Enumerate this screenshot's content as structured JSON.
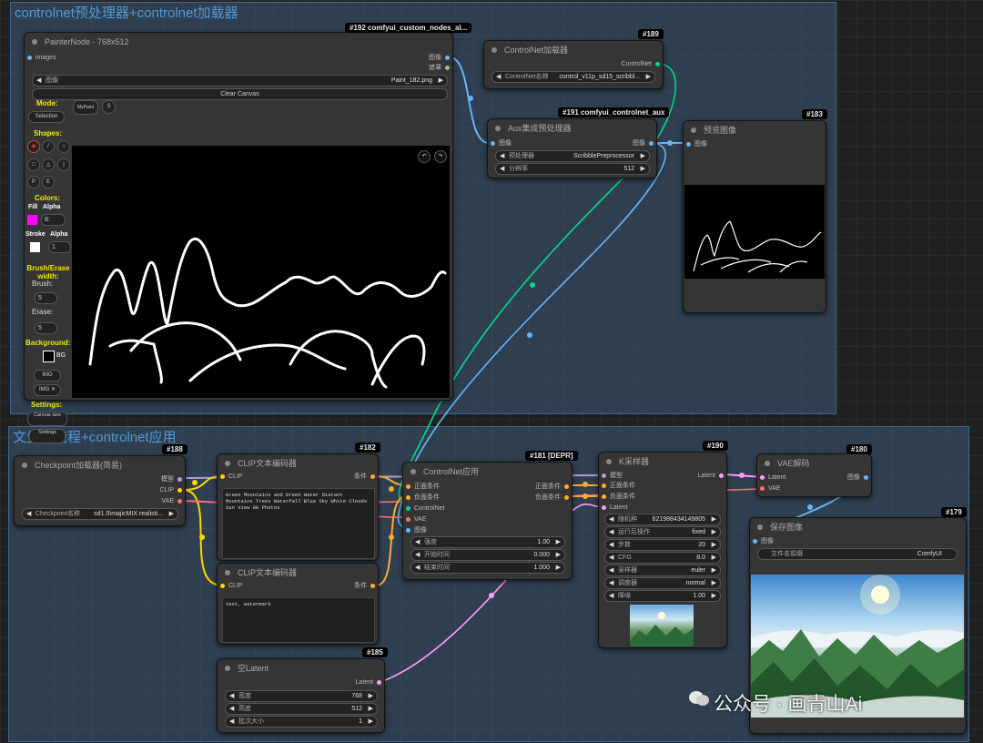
{
  "groups": {
    "top_title": "controlnet预处理器+controlnet加载器",
    "bottom_title": "文生图流程+controlnet应用"
  },
  "painter": {
    "badge": "#192 comfyui_custom_nodes_al...",
    "title": "PainterNode - 768x512",
    "in_images": "images",
    "out_image": "图像",
    "out_mask": "遮罩",
    "image_label": "图像",
    "image_value": "Paint_182.png",
    "clear_canvas": "Clear Canvas",
    "mode_label": "Mode:",
    "mode_selection": "Selection",
    "mode_mypaint": "MyPaint",
    "mode_s": "S",
    "shapes_label": "Shapes:",
    "colors_label": "Colors:",
    "fill_label": "Fill",
    "alpha_label": "Alpha",
    "fill_alpha": "8:",
    "stroke_label": "Stroke",
    "stroke_alpha": "1.",
    "brush_erase_label": "Brush/Erase width:",
    "brush_label": "Brush:",
    "brush_value": "5",
    "erase_label": "Erase:",
    "erase_value": "5",
    "background_label": "Background:",
    "bg_text": "BG",
    "img_button": "IMG",
    "img_x_button": "IMG ✕",
    "settings_label": "Settings:",
    "canvas_size_button": "Canvas size",
    "settings_button": "Settings"
  },
  "cn_loader": {
    "badge": "#189",
    "title": "ControlNet加载器",
    "out": "ControlNet",
    "widget_label": "ControlNet名称",
    "widget_value": "control_v11p_sd15_scribbl..."
  },
  "aux": {
    "badge": "#191 comfyui_controlnet_aux",
    "title": "Aux集成预处理器",
    "in": "图像",
    "out": "图像",
    "pre_label": "预处理器",
    "pre_value": "ScribblePreprocessor",
    "res_label": "分辨率",
    "res_value": "512"
  },
  "preview": {
    "badge": "#183",
    "title": "预览图像",
    "in": "图像"
  },
  "checkpoint": {
    "badge": "#188",
    "title": "Checkpoint加载器(简易)",
    "out_model": "模型",
    "out_clip": "CLIP",
    "out_vae": "VAE",
    "widget_label": "Checkpoint名称",
    "widget_value": "sd1.5\\majicMIX realisti..."
  },
  "clip_pos": {
    "badge": "#182",
    "title": "CLIP文本编码器",
    "in": "CLIP",
    "out": "条件",
    "text": "Green Mountains and Green Water Distant Mountains Trees Waterfall Blue Sky White Clouds Sun View 8K Photos"
  },
  "clip_neg": {
    "title": "CLIP文本编码器",
    "in": "CLIP",
    "out": "条件",
    "text": "text, watermark"
  },
  "cn_apply": {
    "badge": "#181 [DEPR]",
    "title": "ControlNet应用",
    "in_pos": "正面条件",
    "in_neg": "负面条件",
    "in_cn": "ControlNet",
    "in_vae": "VAE",
    "in_img": "图像",
    "out_pos": "正面条件",
    "out_neg": "负面条件",
    "strength_label": "强度",
    "strength_value": "1.00",
    "start_label": "开始时间",
    "start_value": "0.000",
    "end_label": "结束时间",
    "end_value": "1.000"
  },
  "ksampler": {
    "badge": "#190",
    "title": "K采样器",
    "in_model": "模型",
    "in_pos": "正面条件",
    "in_neg": "负面条件",
    "in_latent": "Latent",
    "out": "Latent",
    "seed_label": "随机种",
    "seed_value": "621988434149805",
    "after_label": "运行后操作",
    "after_value": "fixed",
    "steps_label": "步数",
    "steps_value": "20",
    "cfg_label": "CFG",
    "cfg_value": "8.0",
    "sampler_label": "采样器",
    "sampler_value": "euler",
    "scheduler_label": "调度器",
    "scheduler_value": "normal",
    "denoise_label": "降噪",
    "denoise_value": "1.00"
  },
  "vae": {
    "badge": "#180",
    "title": "VAE解码",
    "in_latent": "Latent",
    "in_vae": "VAE",
    "out": "图像"
  },
  "save": {
    "badge": "#179",
    "title": "保存图像",
    "in": "图像",
    "prefix_label": "文件名前缀",
    "prefix_value": "ComfyUI"
  },
  "latent": {
    "badge": "#185",
    "title": "空Latent",
    "out": "Latent",
    "width_label": "宽度",
    "width_value": "768",
    "height_label": "高度",
    "height_value": "512",
    "batch_label": "批次大小",
    "batch_value": "1"
  },
  "watermark": "公众号 · 画青山Ai",
  "colors": {
    "model": "#b39ddb",
    "clip": "#ffd500",
    "vae": "#ff6e6e",
    "conditioning": "#ffa931",
    "latent": "#ff9cf9",
    "image": "#64b5f6",
    "mask": "#81c784",
    "controlnet": "#00d78d"
  }
}
